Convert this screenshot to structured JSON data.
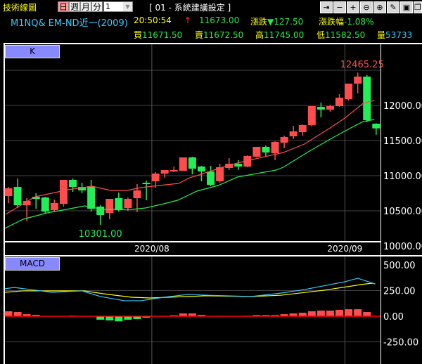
{
  "header": {
    "title": "技術線圖",
    "period_buttons": [
      "日",
      "週",
      "月",
      "分"
    ],
    "period_select": "1",
    "settings_label": "[ 01 - 系統建議設定 ]",
    "toolbar_icons": [
      "pin-icon",
      "minus-icon",
      "plus-icon",
      "zoom-out-icon",
      "zoom-in-icon",
      "draw-icon",
      "save-icon",
      "window-icon"
    ],
    "symbol": "M1NQ& EM-ND近一(2009)",
    "time": "20:50:54",
    "arrow": "↑",
    "last": "11673.00",
    "change_label": "漲跌",
    "change": "▼127.50",
    "change_pct_label": "漲跌幅",
    "change_pct": "-1.08%",
    "bid_label": "買",
    "bid": "11671.50",
    "ask_label": "賣",
    "ask": "11672.50",
    "high_label": "高",
    "high": "11745.00",
    "low_label": "低",
    "low": "11582.50",
    "vol_label": "量",
    "vol": "53733"
  },
  "colors": {
    "up": "#ff4d4d",
    "down": "#22ee55",
    "ma_short": "#ff4d4d",
    "ma_long": "#22ee55",
    "dif": "#33ccff",
    "signal": "#ffff00",
    "zero": "#ff0000"
  },
  "chart_data": [
    {
      "type": "candlestick",
      "panel_label": "K",
      "y_ticks": [
        "12000.00",
        "11500.00",
        "11000.00",
        "10500.00",
        "10000.00"
      ],
      "ylim": [
        10000,
        12500
      ],
      "x_labels": [
        {
          "index": 15.6,
          "text": "2020/08"
        },
        {
          "index": 36.6,
          "text": "2020/09"
        }
      ],
      "annotations": {
        "max": "12465.25",
        "min": "10301.00",
        "max_index": 39,
        "min_index": 10
      },
      "ohlc": [
        [
          10710,
          10840,
          10610,
          10820
        ],
        [
          10840,
          10960,
          10540,
          10580
        ],
        [
          10580,
          10680,
          10350,
          10640
        ],
        [
          10700,
          10750,
          10530,
          10670
        ],
        [
          10690,
          10700,
          10460,
          10490
        ],
        [
          10510,
          10660,
          10490,
          10610
        ],
        [
          10600,
          10940,
          10560,
          10940
        ],
        [
          10940,
          10960,
          10770,
          10840
        ],
        [
          10840,
          10900,
          10750,
          10790
        ],
        [
          10850,
          10940,
          10490,
          10530
        ],
        [
          10560,
          10580,
          10301,
          10440
        ],
        [
          10470,
          10670,
          10380,
          10670
        ],
        [
          10680,
          10760,
          10490,
          10510
        ],
        [
          10540,
          10690,
          10500,
          10670
        ],
        [
          10680,
          10880,
          10480,
          10790
        ],
        [
          10900,
          10930,
          10650,
          10880
        ],
        [
          10920,
          11050,
          10830,
          11030
        ],
        [
          11030,
          11080,
          10970,
          11080
        ],
        [
          11060,
          11130,
          11050,
          11080
        ],
        [
          11070,
          11260,
          11070,
          11260
        ],
        [
          11260,
          11270,
          11020,
          11100
        ],
        [
          11130,
          11140,
          10920,
          11060
        ],
        [
          11060,
          11140,
          10850,
          10870
        ],
        [
          10920,
          11170,
          10900,
          11120
        ],
        [
          11110,
          11250,
          11080,
          11170
        ],
        [
          11170,
          11220,
          11080,
          11130
        ],
        [
          11130,
          11290,
          11120,
          11280
        ],
        [
          11270,
          11410,
          11260,
          11410
        ],
        [
          11410,
          11430,
          11280,
          11330
        ],
        [
          11320,
          11490,
          11220,
          11480
        ],
        [
          11470,
          11570,
          11390,
          11550
        ],
        [
          11560,
          11710,
          11520,
          11630
        ],
        [
          11620,
          11730,
          11570,
          11720
        ],
        [
          11720,
          11990,
          11700,
          11990
        ],
        [
          11980,
          12040,
          11830,
          11940
        ],
        [
          11940,
          12010,
          11910,
          11990
        ],
        [
          11990,
          12160,
          11980,
          12110
        ],
        [
          12090,
          12310,
          12070,
          12310
        ],
        [
          12310,
          12465.25,
          12170,
          12410
        ],
        [
          12410,
          12430,
          11760,
          11790
        ],
        [
          11740,
          11745,
          11582.5,
          11673
        ]
      ],
      "ma_short": [
        [
          -0.3,
          10450
        ],
        [
          2.9,
          10700
        ],
        [
          6.5,
          10800
        ],
        [
          9.1,
          10850
        ],
        [
          11.1,
          10790
        ],
        [
          12.9,
          10790
        ],
        [
          14.4,
          10830
        ],
        [
          15.7,
          10850
        ],
        [
          18.5,
          10890
        ],
        [
          19.7,
          10970
        ],
        [
          20.5,
          11000
        ],
        [
          22.8,
          11100
        ],
        [
          24.9,
          11180
        ],
        [
          29.9,
          11330
        ],
        [
          32.2,
          11450
        ],
        [
          35,
          11680
        ],
        [
          36.6,
          11820
        ],
        [
          38.6,
          12030
        ],
        [
          39.8,
          12070
        ]
      ],
      "ma_long": [
        [
          -0.4,
          10250
        ],
        [
          1.6,
          10380
        ],
        [
          4.2,
          10470
        ],
        [
          6.7,
          10530
        ],
        [
          8.3,
          10570
        ],
        [
          10.3,
          10520
        ],
        [
          13.4,
          10520
        ],
        [
          14.9,
          10540
        ],
        [
          16.9,
          10600
        ],
        [
          18.4,
          10650
        ],
        [
          20.5,
          10780
        ],
        [
          22.8,
          10860
        ],
        [
          24.9,
          10980
        ],
        [
          29.1,
          11080
        ],
        [
          29.9,
          11120
        ],
        [
          32.5,
          11330
        ],
        [
          35,
          11520
        ],
        [
          37.1,
          11670
        ],
        [
          38.6,
          11770
        ],
        [
          39.8,
          11800
        ]
      ]
    },
    {
      "type": "bar+line",
      "panel_label": "MACD",
      "y_ticks": [
        "500.00",
        "250.00",
        "0.00",
        "-250.00"
      ],
      "ylim": [
        -420,
        520
      ],
      "histogram": [
        48,
        41,
        20,
        14,
        0,
        0,
        0,
        6,
        0,
        -3,
        -34,
        -41,
        -50,
        -34,
        -27,
        -14,
        0,
        4,
        10,
        27,
        27,
        14,
        0,
        0,
        0,
        0,
        5,
        12,
        12,
        12,
        20,
        27,
        34,
        48,
        55,
        55,
        62,
        68,
        68,
        41,
        0
      ],
      "dif": [
        [
          -0.4,
          267
        ],
        [
          0.6,
          281
        ],
        [
          2.4,
          260
        ],
        [
          4.7,
          233
        ],
        [
          8,
          247
        ],
        [
          10,
          192
        ],
        [
          12.6,
          151
        ],
        [
          14.4,
          151
        ],
        [
          16.9,
          185
        ],
        [
          19.5,
          212
        ],
        [
          21.5,
          205
        ],
        [
          26.4,
          192
        ],
        [
          29.7,
          226
        ],
        [
          32.2,
          260
        ],
        [
          36.6,
          336
        ],
        [
          38,
          370
        ],
        [
          39.9,
          315
        ]
      ],
      "signal": [
        [
          -0.4,
          233
        ],
        [
          1.6,
          247
        ],
        [
          5.5,
          247
        ],
        [
          8.3,
          247
        ],
        [
          10.3,
          219
        ],
        [
          13.4,
          185
        ],
        [
          15.4,
          178
        ],
        [
          19.5,
          192
        ],
        [
          21.5,
          199
        ],
        [
          26.4,
          192
        ],
        [
          29.7,
          205
        ],
        [
          34.3,
          253
        ],
        [
          38.3,
          308
        ],
        [
          39.6,
          322
        ],
        [
          39.9,
          315
        ]
      ]
    }
  ]
}
